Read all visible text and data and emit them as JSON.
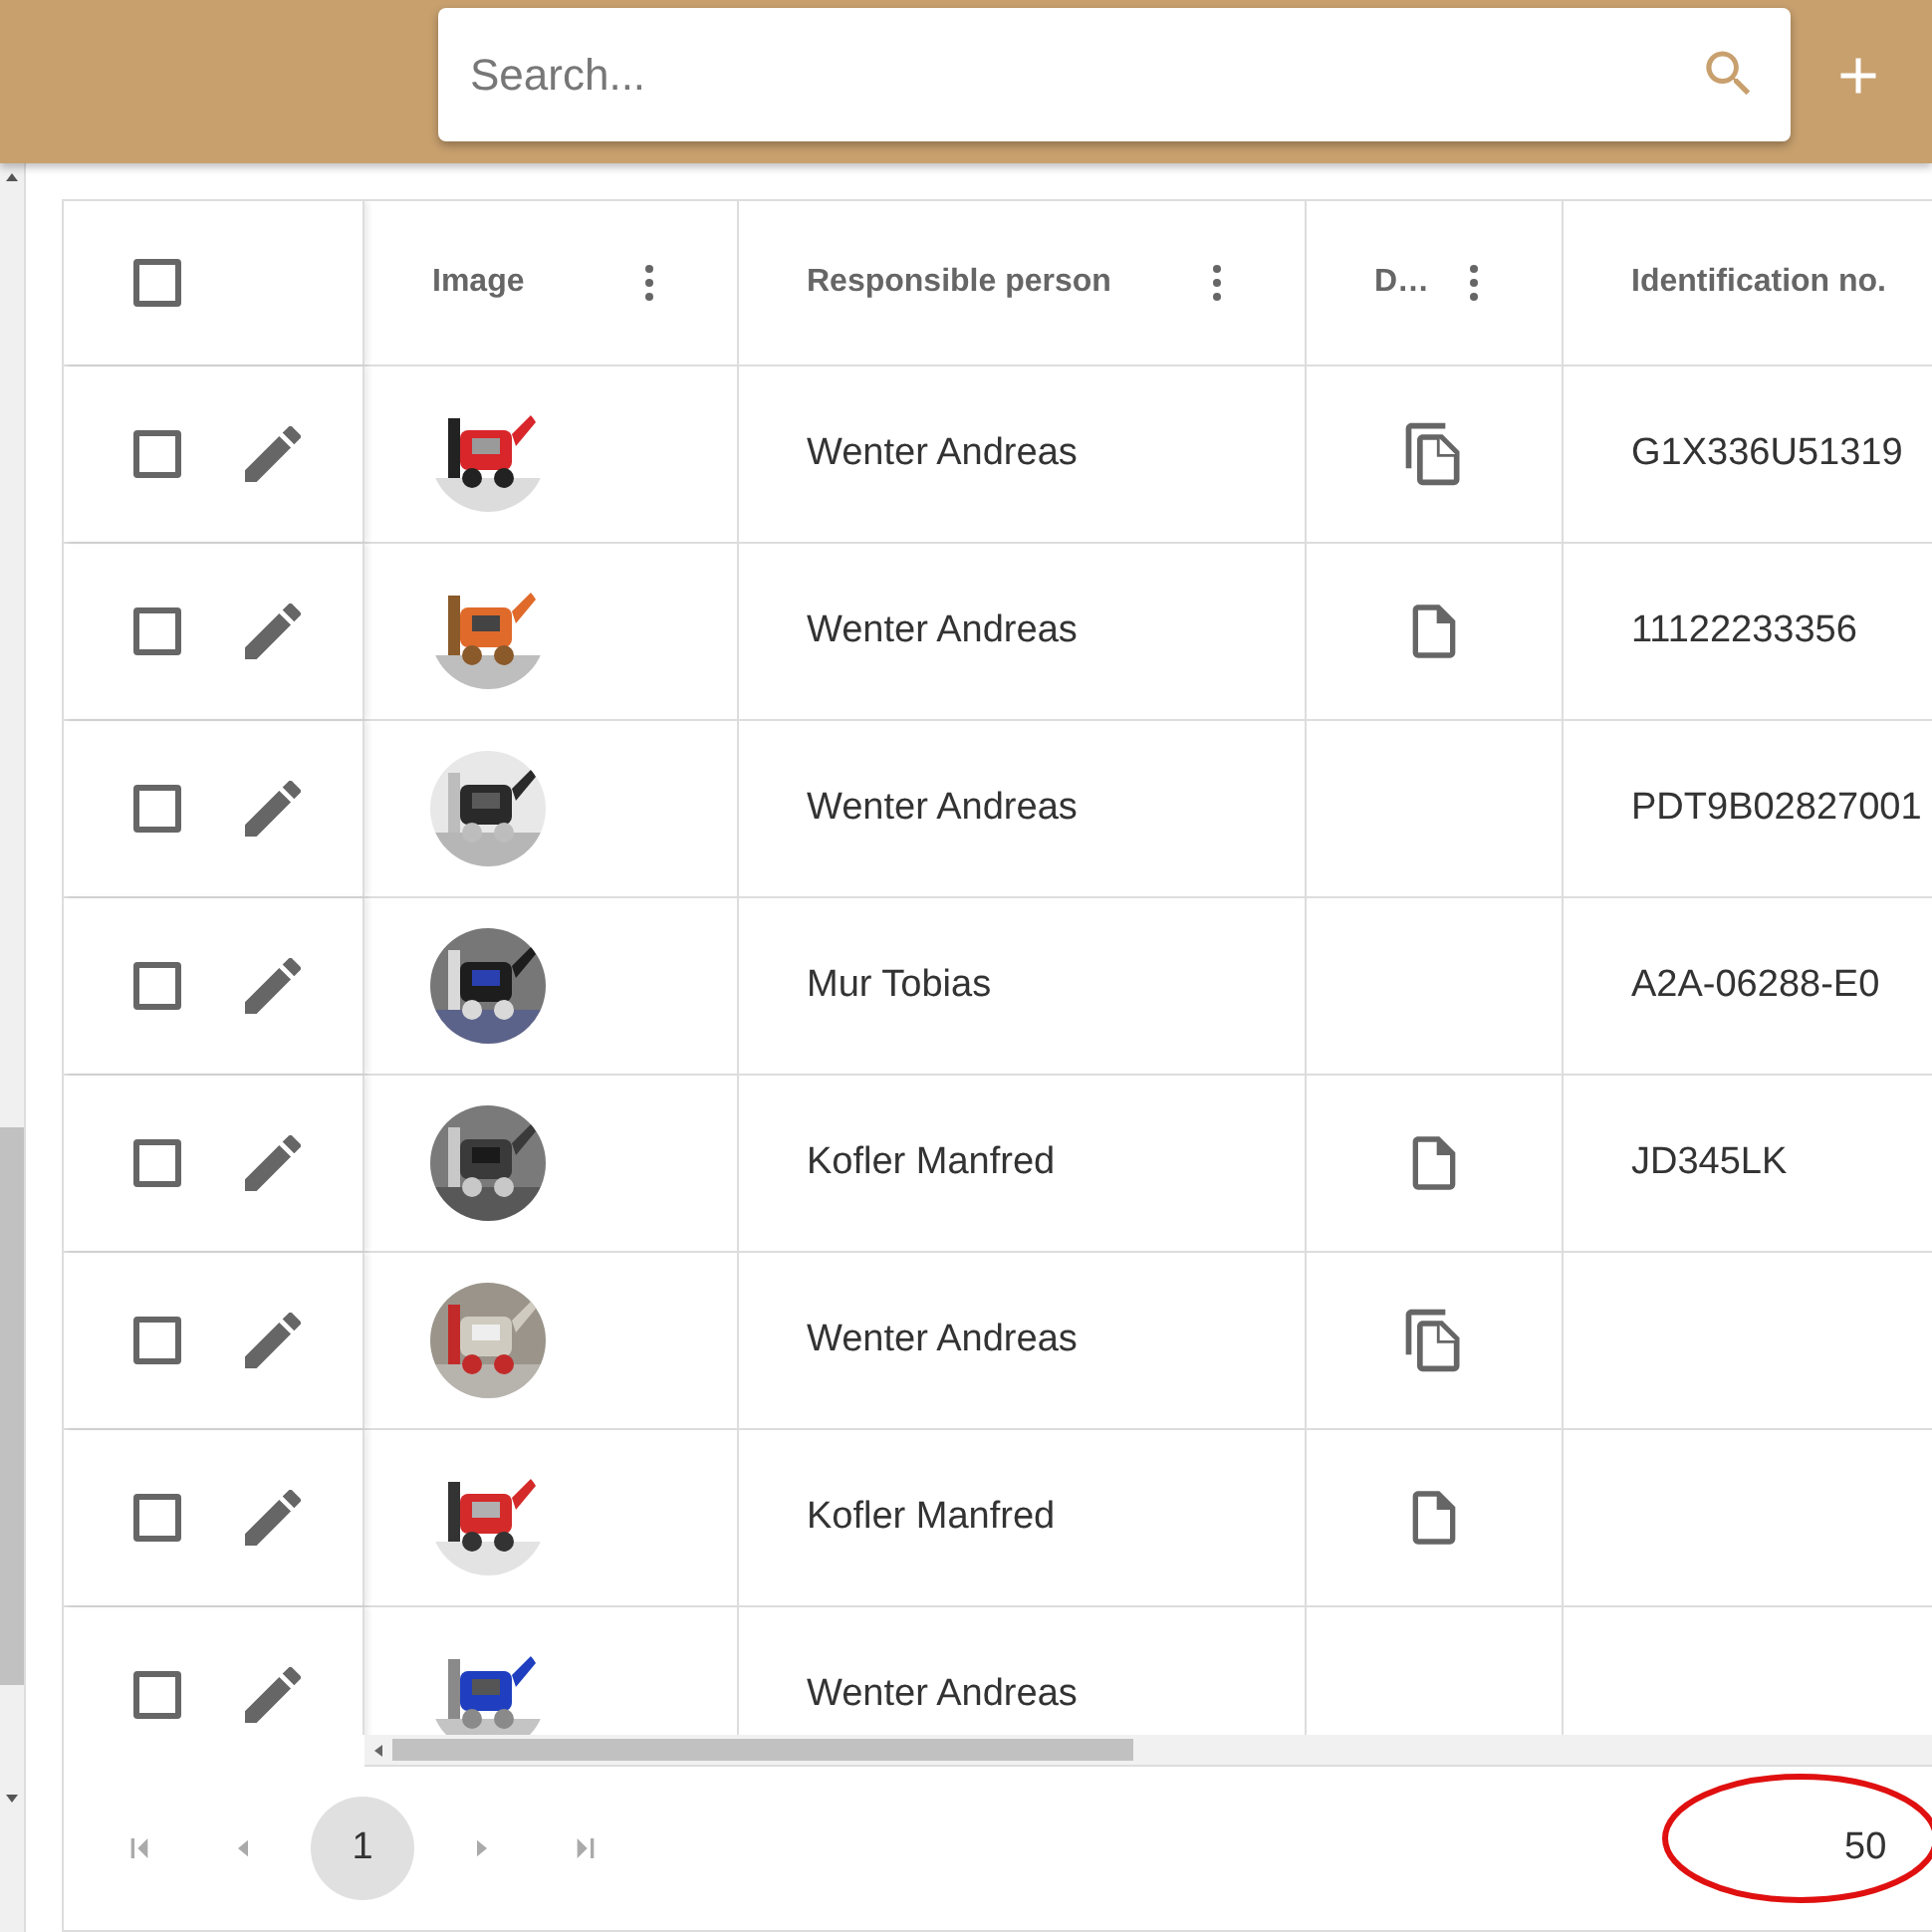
{
  "search": {
    "placeholder": "Search..."
  },
  "table": {
    "select_all": {
      "checked": false
    },
    "columns": [
      {
        "label": "Image"
      },
      {
        "label": "Responsible person"
      },
      {
        "label": "D…"
      },
      {
        "label": "Identification no."
      }
    ],
    "rows": [
      {
        "checked": false,
        "person": "Wenter Andreas",
        "document": {
          "kind": "multiple"
        },
        "identification": "G1X336U51319"
      },
      {
        "checked": false,
        "person": "Wenter Andreas",
        "document": {
          "kind": "single"
        },
        "identification": "11122233356"
      },
      {
        "checked": false,
        "person": "Wenter Andreas",
        "identification": "PDT9B02827001"
      },
      {
        "checked": false,
        "person": "Mur Tobias",
        "identification": "A2A-06288-E0"
      },
      {
        "checked": false,
        "person": "Kofler Manfred",
        "document": {
          "kind": "single"
        },
        "identification": "JD345LK"
      },
      {
        "checked": false,
        "person": "Wenter Andreas",
        "document": {
          "kind": "multiple"
        }
      },
      {
        "checked": false,
        "person": "Kofler Manfred",
        "document": {
          "kind": "single"
        }
      },
      {
        "checked": false,
        "person": "Wenter Andreas"
      }
    ]
  },
  "pagination": {
    "pages": [
      {
        "label": "1",
        "selected": true
      }
    ],
    "page_size": "50"
  }
}
